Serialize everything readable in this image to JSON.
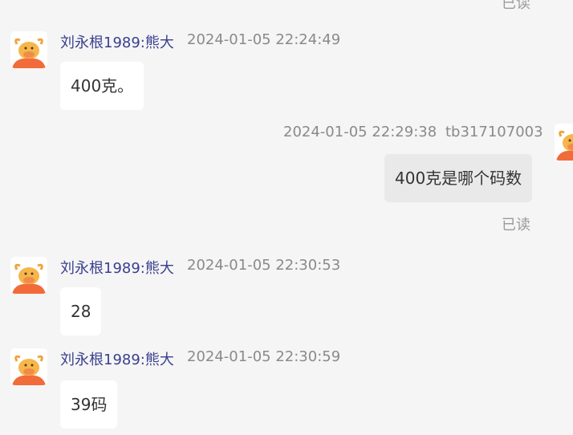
{
  "messages": [
    {
      "kind": "read_status",
      "text": "已读"
    },
    {
      "kind": "incoming",
      "sender": "刘永根1989:熊大",
      "time": "2024-01-05 22:24:49",
      "text": "400克。"
    },
    {
      "kind": "outgoing",
      "sender": "tb317107003",
      "time": "2024-01-05 22:29:38",
      "text": "400克是哪个码数",
      "status": "已读"
    },
    {
      "kind": "incoming",
      "sender": "刘永根1989:熊大",
      "time": "2024-01-05 22:30:53",
      "text": "28"
    },
    {
      "kind": "incoming",
      "sender": "刘永根1989:熊大",
      "time": "2024-01-05 22:30:59",
      "text": "39码"
    }
  ],
  "avatar": {
    "icon": "bull-avatar-icon",
    "colors": {
      "body": "#f26b3a",
      "face": "#f6b64a",
      "bg": "#ffffff"
    }
  }
}
